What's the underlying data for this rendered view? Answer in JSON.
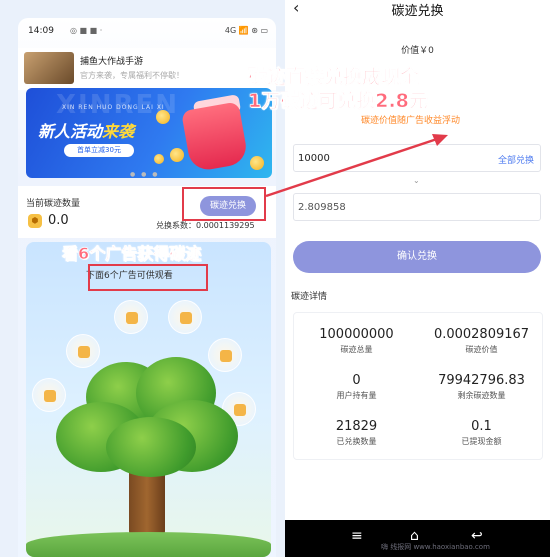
{
  "left": {
    "status": {
      "time": "14:09",
      "icons": "◎ ■ ■ ·",
      "right": "4G 📶 ⊛ ▭"
    },
    "ad": {
      "title": "捕鱼大作战手游",
      "subtitle": "官方来袭，专属福利不停歇！"
    },
    "banner": {
      "watermark": "XINREN",
      "small_text": "XIN REN HUO DONG LAI XI",
      "title_a": "新人活动",
      "title_b": "来袭",
      "button": "首单立减30元"
    },
    "carbon": {
      "label": "当前碳迹数量",
      "value": "0.0",
      "exchange_button": "碳迹兑换",
      "coefficient": "兑换系数：0.0001139295"
    },
    "tree": {
      "hint": "下面6个广告可供观看"
    }
  },
  "annotations": {
    "line1": "碳迹直接兑换成现金",
    "line2": "1万碳迹可兑换2.8元",
    "watch": "看6个广告获得碳迹"
  },
  "right": {
    "title": "碳迹兑换",
    "value": "价值￥0",
    "float_note": "碳迹价值随广告收益浮动",
    "input_value": "10000",
    "all_exchange": "全部兑换",
    "output_value": "2.809858",
    "confirm": "确认兑换",
    "details_title": "碳迹详情",
    "details": [
      {
        "value": "100000000",
        "label": "碳迹总量"
      },
      {
        "value": "0.0002809167",
        "label": "碳迹价值"
      },
      {
        "value": "0",
        "label": "用户持有量"
      },
      {
        "value": "79942796.83",
        "label": "剩余碳迹数量"
      },
      {
        "value": "21829",
        "label": "已兑换数量"
      },
      {
        "value": "0.1",
        "label": "已提现金额"
      }
    ],
    "watermark": "嗨 线报网  www.haoxianbao.com"
  }
}
